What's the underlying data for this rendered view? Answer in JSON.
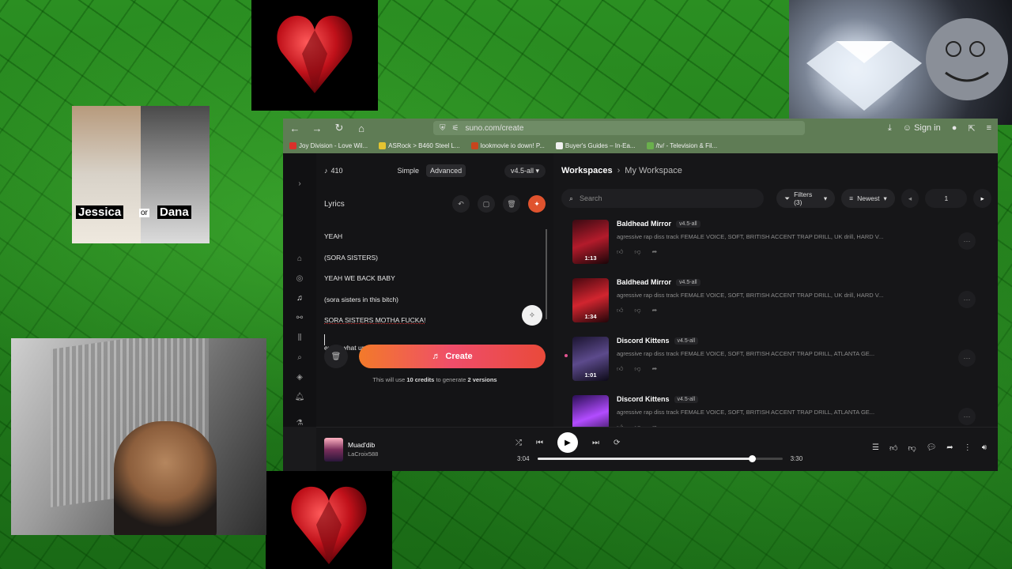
{
  "overlays": {
    "jessica_label": "Jessica",
    "or_label": "or",
    "dana_label": "Dana"
  },
  "browser": {
    "url": "suno.com/create",
    "sign_in": "Sign in",
    "bookmarks": [
      {
        "label": "Joy Division - Love Wil...",
        "color": "#d9302a"
      },
      {
        "label": "ASRock > B460 Steel L...",
        "color": "#e3c431"
      },
      {
        "label": "lookmovie io down! P...",
        "color": "#c8451e"
      },
      {
        "label": "Buyer's Guides – In-Ea...",
        "color": "#f0f0f0"
      },
      {
        "label": "/tv/ - Television & Fil...",
        "color": "#6ab04c"
      }
    ]
  },
  "create_panel": {
    "credits": "410",
    "mode_simple": "Simple",
    "mode_advanced": "Advanced",
    "version": "v4.5-all",
    "lyrics_title": "Lyrics",
    "lyrics_lines": [
      "YEAH",
      "(SORA SISTERS)",
      "YEAH WE BACK BABY",
      "(sora sisters in this bitch)",
      "SORA SISTERS MOTHA FUCKA!"
    ],
    "last_line": "ey yo what up felix (ha ha)",
    "create_label": "Create",
    "note_prefix": "This will use ",
    "note_credits": "10 credits",
    "note_mid": " to generate ",
    "note_versions": "2 versions"
  },
  "workspace": {
    "crumb_root": "Workspaces",
    "crumb_current": "My Workspace",
    "search_placeholder": "Search",
    "filters_label": "Filters (3)",
    "sort_label": "Newest",
    "page": "1",
    "tracks": [
      {
        "title": "Baldhead Mirror",
        "version": "v4.5-all",
        "duration": "1:13",
        "desc": "agressive rap diss track FEMALE VOICE, SOFT, BRITISH ACCENT TRAP DRILL, UK drill, HARD V...",
        "colors": [
          "#3a0a12",
          "#b31b2b",
          "#1a0508"
        ]
      },
      {
        "title": "Baldhead Mirror",
        "version": "v4.5-all",
        "duration": "1:34",
        "desc": "agressive rap diss track FEMALE VOICE, SOFT, BRITISH ACCENT TRAP DRILL, UK drill, HARD V...",
        "colors": [
          "#4a0810",
          "#d1252f",
          "#220509"
        ]
      },
      {
        "title": "Discord Kittens",
        "version": "v4.5-all",
        "duration": "1:01",
        "desc": "agressive rap diss track FEMALE VOICE, SOFT, BRITISH ACCENT TRAP DRILL, ATLANTA GE...",
        "colors": [
          "#1b1430",
          "#5c4a8c",
          "#0d0a18"
        ]
      },
      {
        "title": "Discord Kittens",
        "version": "v4.5-all",
        "duration": "",
        "desc": "agressive rap diss track FEMALE VOICE, SOFT, BRITISH ACCENT TRAP DRILL, ATLANTA GE...",
        "colors": [
          "#2a0e55",
          "#b24cff",
          "#130726"
        ]
      }
    ]
  },
  "player": {
    "title": "Muad'dib",
    "artist": "LaCroix588",
    "elapsed": "3:04",
    "total": "3:30",
    "progress": 0.876
  }
}
